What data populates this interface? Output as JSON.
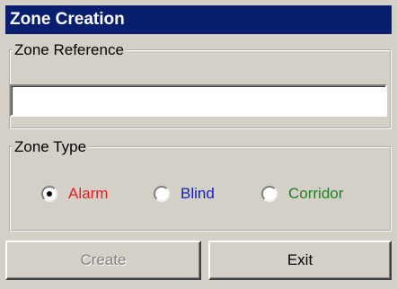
{
  "window": {
    "title": "Zone Creation"
  },
  "zone_reference": {
    "legend": "Zone Reference",
    "value": ""
  },
  "zone_type": {
    "legend": "Zone Type",
    "options": [
      {
        "label": "Alarm",
        "checked": true,
        "color": "#e02020"
      },
      {
        "label": "Blind",
        "checked": false,
        "color": "#1020c0"
      },
      {
        "label": "Corridor",
        "checked": false,
        "color": "#208020"
      }
    ]
  },
  "buttons": {
    "create": {
      "label": "Create",
      "enabled": false
    },
    "exit": {
      "label": "Exit",
      "enabled": true
    }
  }
}
